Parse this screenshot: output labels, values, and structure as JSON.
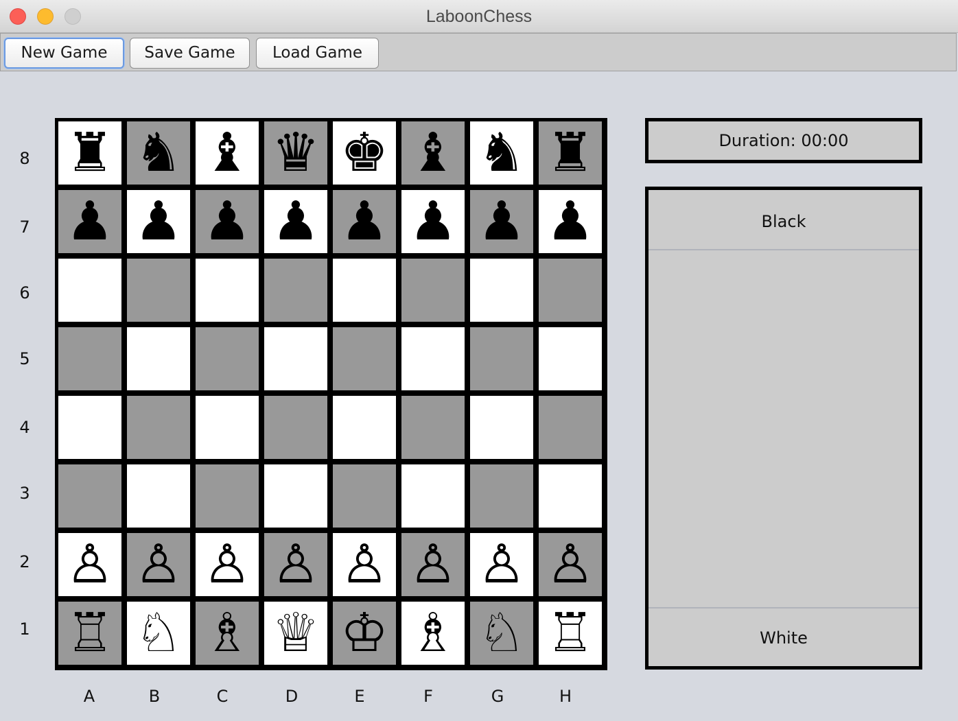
{
  "window": {
    "title": "LaboonChess"
  },
  "toolbar": {
    "new_game": "New Game",
    "save_game": "Save Game",
    "load_game": "Load Game"
  },
  "board": {
    "ranks": [
      "8",
      "7",
      "6",
      "5",
      "4",
      "3",
      "2",
      "1"
    ],
    "files": [
      "A",
      "B",
      "C",
      "D",
      "E",
      "F",
      "G",
      "H"
    ],
    "pieces": [
      [
        "♜",
        "♞",
        "♝",
        "♛",
        "♚",
        "♝",
        "♞",
        "♜"
      ],
      [
        "♟",
        "♟",
        "♟",
        "♟",
        "♟",
        "♟",
        "♟",
        "♟"
      ],
      [
        "",
        "",
        "",
        "",
        "",
        "",
        "",
        ""
      ],
      [
        "",
        "",
        "",
        "",
        "",
        "",
        "",
        ""
      ],
      [
        "",
        "",
        "",
        "",
        "",
        "",
        "",
        ""
      ],
      [
        "",
        "",
        "",
        "",
        "",
        "",
        "",
        ""
      ],
      [
        "♙",
        "♙",
        "♙",
        "♙",
        "♙",
        "♙",
        "♙",
        "♙"
      ],
      [
        "♖",
        "♘",
        "♗",
        "♕",
        "♔",
        "♗",
        "♘",
        "♖"
      ]
    ],
    "light_color": "#ffffff",
    "dark_color": "#999999"
  },
  "status": {
    "duration": "Duration: 00:00",
    "black_label": "Black",
    "white_label": "White"
  }
}
